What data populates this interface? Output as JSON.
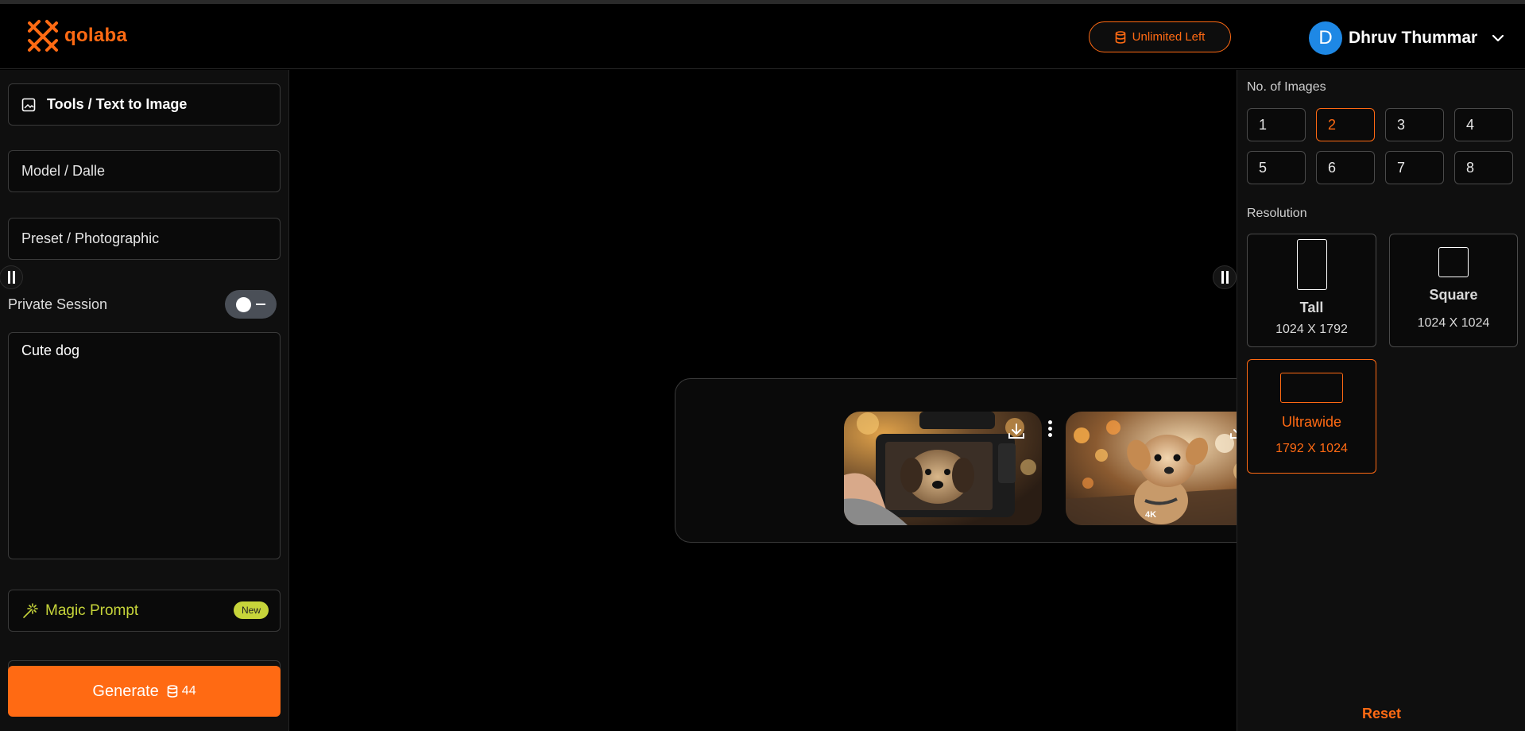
{
  "header": {
    "logo_text": "qolaba",
    "credits_label": "Unlimited Left",
    "user": {
      "initial": "D",
      "name": "Dhruv Thummar"
    }
  },
  "sidebar": {
    "tool": "Tools / Text to Image",
    "model": "Model / Dalle",
    "preset": "Preset / Photographic",
    "private_session_label": "Private Session",
    "private_session_on": false,
    "prompt_value": "Cute dog",
    "magic_prompt_label": "Magic Prompt",
    "magic_prompt_badge": "New",
    "generate_label": "Generate",
    "generate_cost": "44"
  },
  "results": {
    "images": [
      {
        "alt": "dog on camera screen",
        "overlay": ""
      },
      {
        "alt": "puppy with bokeh",
        "overlay": "4K"
      }
    ]
  },
  "settings": {
    "num_images_label": "No. of Images",
    "num_options": [
      "1",
      "2",
      "3",
      "4",
      "5",
      "6",
      "7",
      "8"
    ],
    "num_selected": "2",
    "resolution_label": "Resolution",
    "resolutions": [
      {
        "name": "Tall",
        "size": "1024 X 1792"
      },
      {
        "name": "Square",
        "size": "1024 X 1024"
      },
      {
        "name": "Ultrawide",
        "size": "1792 X 1024"
      }
    ],
    "resolution_selected": "Ultrawide",
    "reset_label": "Reset"
  },
  "colors": {
    "accent": "#ff6a13",
    "magic": "#c6d43a",
    "avatar": "#1e88e5"
  }
}
